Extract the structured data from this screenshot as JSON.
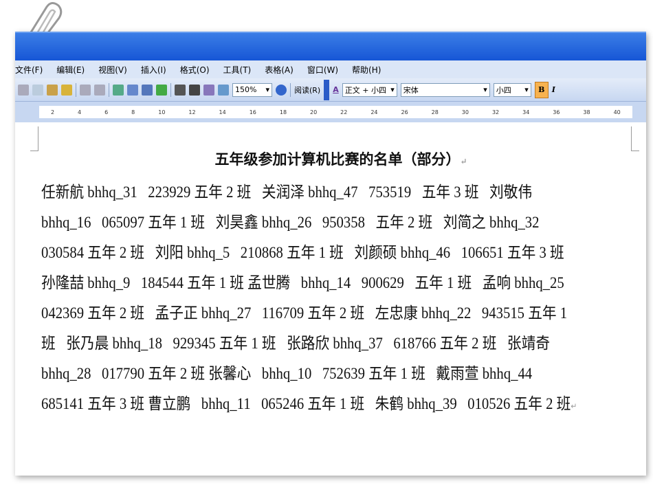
{
  "menu": [
    "文件(F)",
    "编辑(E)",
    "视图(V)",
    "插入(I)",
    "格式(O)",
    "工具(T)",
    "表格(A)",
    "窗口(W)",
    "帮助(H)"
  ],
  "toolbar": {
    "zoom": "150%",
    "read_label": "阅读(R)",
    "style": "正文 + 小四",
    "font": "宋体",
    "size": "小四",
    "bold": "B",
    "italic": "I"
  },
  "ruler": [
    "2",
    "4",
    "6",
    "8",
    "10",
    "12",
    "14",
    "16",
    "18",
    "20",
    "22",
    "24",
    "26",
    "28",
    "30",
    "32",
    "34",
    "36",
    "38",
    "40"
  ],
  "document": {
    "title": "五年级参加计算机比赛的名单（部分）",
    "lines": [
      "任新航 bhhq_31   223929 五年 2 班   关润泽 bhhq_47   753519   五年 3 班   刘敬伟",
      "bhhq_16   065097 五年 1 班   刘昊鑫 bhhq_26   950358   五年 2 班   刘简之 bhhq_32",
      "030584 五年 2 班   刘阳 bhhq_5   210868 五年 1 班   刘颜硕 bhhq_46   106651 五年 3 班",
      "孙隆喆 bhhq_9   184544 五年 1 班 孟世腾   bhhq_14   900629   五年 1 班   孟响 bhhq_25",
      "042369 五年 2 班   孟子正 bhhq_27   116709 五年 2 班   左忠康 bhhq_22   943515 五年 1",
      "班   张乃晨 bhhq_18   929345 五年 1 班   张路欣 bhhq_37   618766 五年 2 班   张靖奇",
      "bhhq_28   017790 五年 2 班 张馨心   bhhq_10   752639 五年 1 班   戴雨萱 bhhq_44",
      "685141 五年 3 班 曹立鹏   bhhq_11   065246 五年 1 班   朱鹤 bhhq_39   010526 五年 2 班"
    ],
    "para_mark": "↵"
  }
}
